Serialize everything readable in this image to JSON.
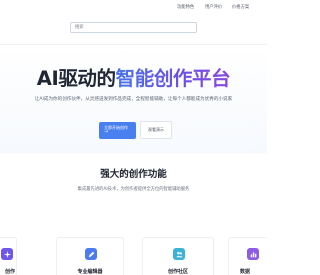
{
  "nav": {
    "links": [
      "功能特色",
      "用户评价",
      "价格方案"
    ]
  },
  "search": {
    "placeholder": "搜索"
  },
  "hero": {
    "title_plain": "AI驱动的",
    "title_highlight": "智能创作平台",
    "subtitle": "让AI成为你的创作伙伴，从灵感迸发到作品完成，全程智能辅助，让每个人都能成为优秀的小说家",
    "primary_button": "立即开始创作",
    "primary_button_icon": "→",
    "secondary_button": "观看演示"
  },
  "features": {
    "title": "强大的创作功能",
    "subtitle": "集成最先进的AI技术，为创作者提供全方位的智能辅助服务",
    "cards": [
      {
        "title": "创作",
        "icon": "sparkle-icon",
        "icon_color": "#6f58e8"
      },
      {
        "title": "专业编辑器",
        "icon": "pen-icon",
        "icon_color": "#4d7cf0"
      },
      {
        "title": "创作社区",
        "icon": "people-icon",
        "icon_color": "#3bb2d6"
      },
      {
        "title": "数据",
        "icon": "chart-icon",
        "icon_color": "#8d5be4"
      }
    ]
  },
  "colors": {
    "accent": "#4a7ff0",
    "title_gradient_start": "#4a73ea",
    "title_gradient_end": "#8a46de"
  }
}
